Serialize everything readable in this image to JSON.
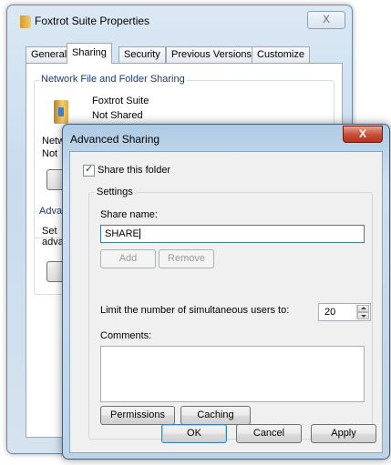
{
  "properties_window": {
    "title": "Foxtrot Suite Properties",
    "close_glyph": "X",
    "tabs": [
      {
        "label": "General",
        "active": false
      },
      {
        "label": "Sharing",
        "active": true
      },
      {
        "label": "Security",
        "active": false
      },
      {
        "label": "Previous Versions",
        "active": false
      },
      {
        "label": "Customize",
        "active": false
      }
    ],
    "network_sharing": {
      "group_title": "Network File and Folder Sharing",
      "folder_name": "Foxtrot Suite",
      "folder_status": "Not Shared",
      "net_path_label_partial": "Netw",
      "not_shared_partial": "Not"
    },
    "advanced_partial": {
      "group_title_partial": "Adva",
      "line1_partial": "Set",
      "line2_partial": "adva"
    }
  },
  "advanced_sharing": {
    "title": "Advanced Sharing",
    "close_glyph": "X",
    "share_checkbox_label": "Share this folder",
    "share_checkbox_checked": true,
    "settings_group_title": "Settings",
    "share_name_label": "Share name:",
    "share_name_value": "SHARE",
    "add_label": "Add",
    "remove_label": "Remove",
    "limit_label": "Limit the number of simultaneous users to:",
    "limit_value": "20",
    "comments_label": "Comments:",
    "comments_value": "",
    "permissions_label": "Permissions",
    "caching_label": "Caching",
    "ok_label": "OK",
    "cancel_label": "Cancel",
    "apply_label": "Apply"
  },
  "colors": {
    "title_bar": "#c9dced",
    "dialog_frame": "#bcd3e8",
    "close_red": "#c8523b",
    "group_title_text": "#1e3a6e"
  }
}
